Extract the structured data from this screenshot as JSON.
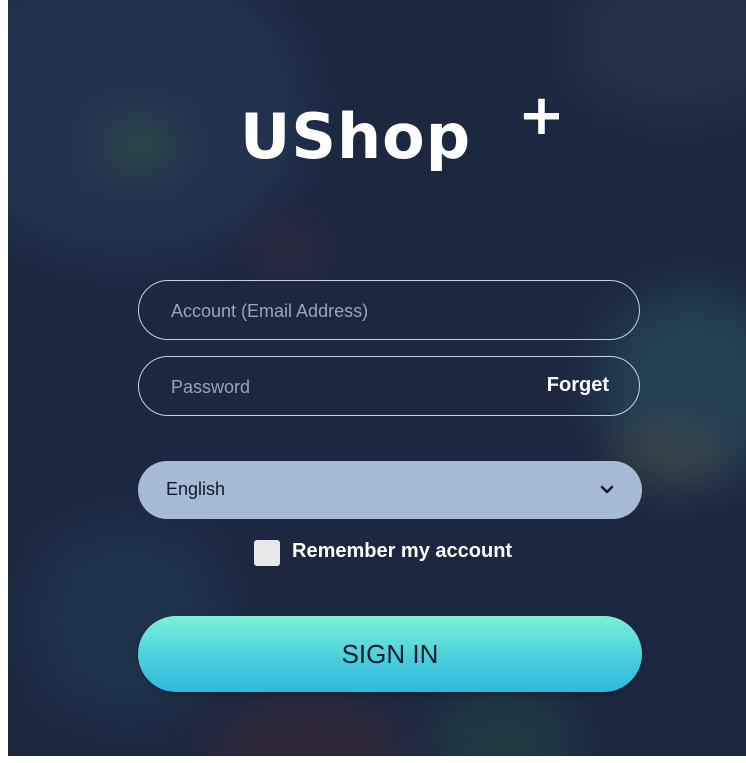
{
  "brand": {
    "name": "UShop",
    "plus": "+"
  },
  "form": {
    "account_placeholder": "Account (Email Address)",
    "password_placeholder": "Password",
    "forget_label": "Forget",
    "language_value": "English",
    "remember_label": "Remember my account",
    "signin_label": "SIGN IN"
  },
  "colors": {
    "background": "#1b2840",
    "select_fill": "#a8bbd4",
    "button_gradient_top": "#7df0d6",
    "button_gradient_bottom": "#2fb8dc"
  },
  "icons": {
    "dropdown": "chevron-down-icon",
    "remember": "checkbox"
  }
}
